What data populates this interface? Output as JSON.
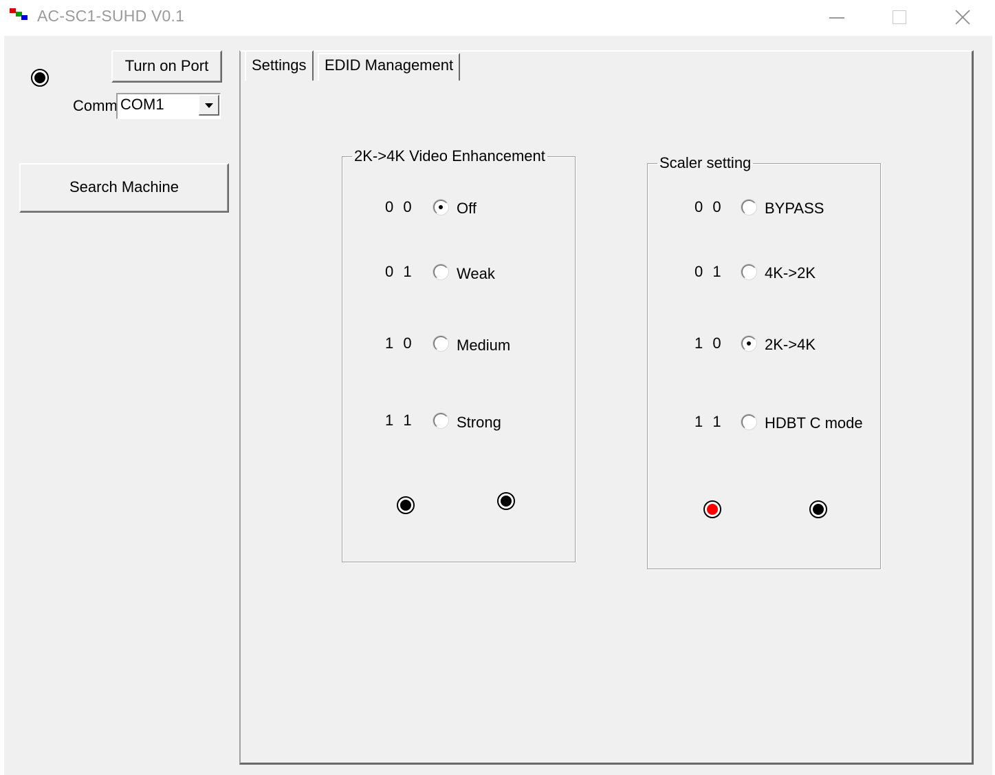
{
  "window": {
    "title": "AC-SC1-SUHD V0.1"
  },
  "left_panel": {
    "turn_on_port_label": "Turn on Port",
    "comm_label": "Comm:",
    "comm_value": "COM1",
    "search_machine_label": "Search Machine"
  },
  "tabs": [
    {
      "label": "Settings",
      "active": true
    },
    {
      "label": "EDID Management",
      "active": false
    }
  ],
  "enhancement": {
    "title": "2K->4K Video Enhancement",
    "options": [
      {
        "code": "0 0",
        "label": "Off",
        "checked": true
      },
      {
        "code": "0 1",
        "label": "Weak",
        "checked": false
      },
      {
        "code": "1 0",
        "label": "Medium",
        "checked": false
      },
      {
        "code": "1 1",
        "label": "Strong",
        "checked": false
      }
    ],
    "indicators": [
      "black",
      "black"
    ]
  },
  "scaler": {
    "title": "Scaler setting",
    "options": [
      {
        "code": "0 0",
        "label": "BYPASS",
        "checked": false
      },
      {
        "code": "0 1",
        "label": "4K->2K",
        "checked": false
      },
      {
        "code": "1 0",
        "label": "2K->4K",
        "checked": true
      },
      {
        "code": "1 1",
        "label": "HDBT C mode",
        "checked": false
      }
    ],
    "indicators": [
      "red",
      "black"
    ]
  },
  "colors": {
    "background": "#f0f0f0",
    "indicator_red": "#ff0000",
    "indicator_black": "#000000"
  }
}
